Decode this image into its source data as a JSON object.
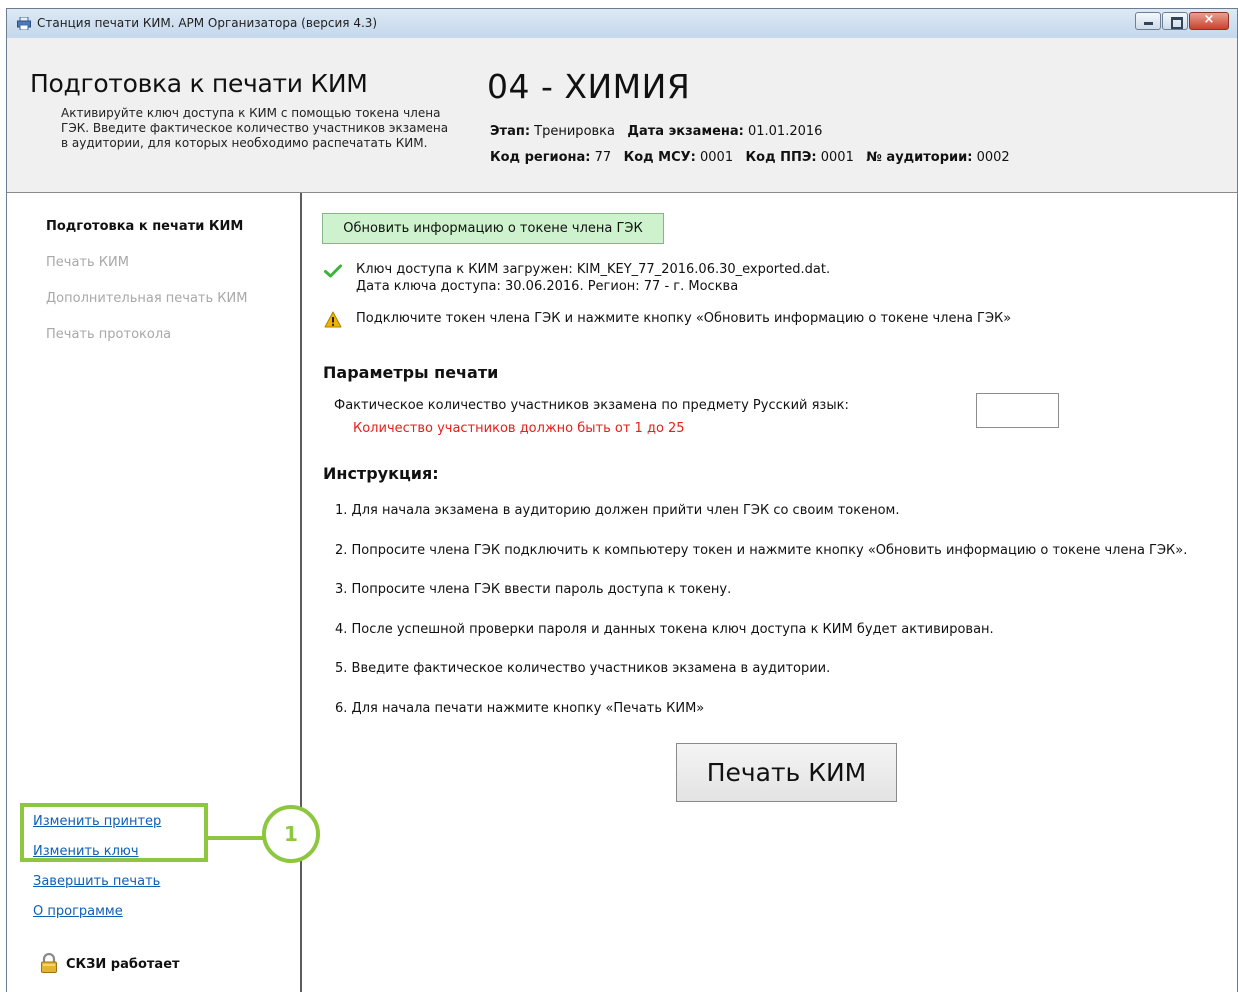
{
  "window": {
    "title": "Станция печати КИМ. АРМ Организатора (версия 4.3)",
    "controls": [
      "minimize-icon",
      "maximize-icon",
      "close-icon"
    ],
    "close_glyph": "×"
  },
  "header": {
    "title": "Подготовка к печати КИМ",
    "description": "Активируйте ключ доступа к КИМ с помощью токена члена ГЭК. Введите фактическое количество участников экзамена в аудитории, для которых необходимо распечатать КИМ.",
    "subject": "04 - ХИМИЯ",
    "stage_label": "Этап:",
    "stage_value": "Тренировка",
    "date_label": "Дата экзамена:",
    "date_value": "01.01.2016",
    "region_label": "Код региона:",
    "region_value": "77",
    "msu_label": "Код МСУ:",
    "msu_value": "0001",
    "ppe_label": "Код ППЭ:",
    "ppe_value": "0001",
    "room_label": "№ аудитории:",
    "room_value": "0002"
  },
  "sidebar": {
    "nav": [
      {
        "label": "Подготовка к печати КИМ",
        "active": true
      },
      {
        "label": "Печать КИМ",
        "active": false
      },
      {
        "label": "Дополнительная печать КИМ",
        "active": false
      },
      {
        "label": "Печать протокола",
        "active": false
      }
    ],
    "links": [
      "Изменить принтер",
      "Изменить ключ",
      "Завершить печать",
      "О программе"
    ],
    "callout_number": "1",
    "status": "СКЗИ работает",
    "status_icon": "lock-icon"
  },
  "main": {
    "refresh_button": "Обновить информацию о токене члена ГЭК",
    "key_loaded_line1": "Ключ доступа к КИМ загружен: KIM_KEY_77_2016.06.30_exported.dat.",
    "key_loaded_line2": "Дата ключа доступа: 30.06.2016. Регион: 77 - г. Москва",
    "warning": "Подключите токен члена ГЭК и нажмите кнопку «Обновить информацию о токене члена ГЭК»",
    "print_params_title": "Параметры печати",
    "participants_label": "Фактическое количество участников экзамена по предмету Русский язык:",
    "participants_value": "",
    "participants_error": "Количество участников должно быть от 1 до 25",
    "instruction_title": "Инструкция:",
    "instructions": [
      "1. Для начала экзамена в аудиторию должен прийти член ГЭК со своим токеном.",
      "2. Попросите члена ГЭК подключить к компьютеру токен и нажмите кнопку «Обновить информацию о токене члена ГЭК».",
      "3. Попросите члена ГЭК ввести пароль доступа к токену.",
      "4. После успешной проверки пароля и данных токена ключ доступа к КИМ будет активирован.",
      "5. Введите фактическое количество участников экзамена в аудитории.",
      "6. Для начала печати нажмите кнопку «Печать КИМ»"
    ],
    "print_button": "Печать КИМ"
  },
  "colors": {
    "highlight": "#8dc63f",
    "error": "#e8201a",
    "link": "#0f5fb5",
    "refresh_button_bg": "#cdf2cd",
    "check": "#3cb43c",
    "warning": "#f0b400"
  }
}
